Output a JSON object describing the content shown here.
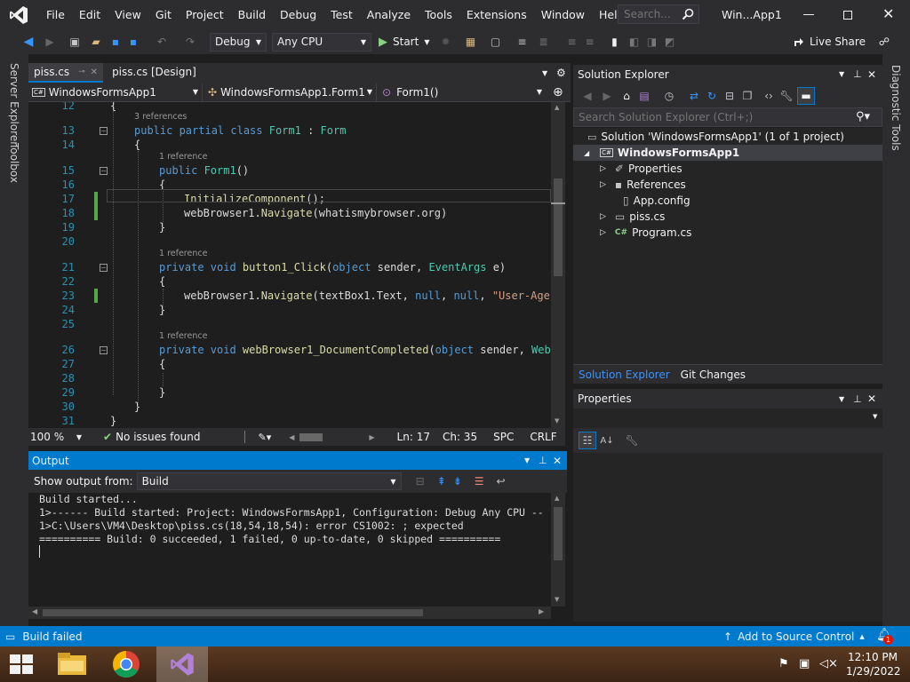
{
  "menubar": {
    "items": [
      "File",
      "Edit",
      "View",
      "Git",
      "Project",
      "Build",
      "Debug",
      "Test",
      "Analyze",
      "Tools",
      "Extensions",
      "Window",
      "Help"
    ],
    "search_placeholder": "Search...",
    "window_title": "Win...App1"
  },
  "toolbar": {
    "config": "Debug",
    "platform": "Any CPU",
    "start_label": "Start",
    "live_share_label": "Live Share"
  },
  "left_tabs": {
    "server_explorer": "Server Explorer",
    "toolbox": "Toolbox"
  },
  "right_tabs": {
    "diagnostic_tools": "Diagnostic Tools"
  },
  "editor": {
    "tabs": [
      "piss.cs",
      "piss.cs [Design]"
    ],
    "nav": {
      "project": "WindowsFormsApp1",
      "class": "WindowsFormsApp1.Form1",
      "member": "Form1()"
    },
    "lines": [
      {
        "n": "12",
        "parts": [
          {
            "t": "{",
            "c": ""
          }
        ]
      },
      {
        "n": "13",
        "lens": "3 references",
        "parts": [
          {
            "t": "public ",
            "c": "kw"
          },
          {
            "t": "partial ",
            "c": "kw"
          },
          {
            "t": "class ",
            "c": "kw"
          },
          {
            "t": "Form1",
            "c": "ty"
          },
          {
            "t": " : ",
            "c": ""
          },
          {
            "t": "Form",
            "c": "ty"
          }
        ]
      },
      {
        "n": "14",
        "parts": [
          {
            "t": "{",
            "c": ""
          }
        ]
      },
      {
        "n": "15",
        "lens": "1 reference",
        "parts": [
          {
            "t": "public ",
            "c": "kw"
          },
          {
            "t": "Form1",
            "c": "ty"
          },
          {
            "t": "()",
            "c": ""
          }
        ]
      },
      {
        "n": "16",
        "parts": [
          {
            "t": "{",
            "c": ""
          }
        ]
      },
      {
        "n": "17",
        "parts": [
          {
            "t": "InitializeComponent",
            "c": "fn"
          },
          {
            "t": "();",
            "c": ""
          }
        ]
      },
      {
        "n": "18",
        "parts": [
          {
            "t": "webBrowser1",
            "c": ""
          },
          {
            "t": ".",
            "c": ""
          },
          {
            "t": "Navigate",
            "c": "fn"
          },
          {
            "t": "(whatismybrowser.org)",
            "c": ""
          }
        ]
      },
      {
        "n": "19",
        "parts": [
          {
            "t": "}",
            "c": ""
          }
        ]
      },
      {
        "n": "20",
        "parts": [
          {
            "t": "",
            "c": ""
          }
        ]
      },
      {
        "n": "21",
        "lens": "1 reference",
        "parts": [
          {
            "t": "private ",
            "c": "kw"
          },
          {
            "t": "void ",
            "c": "kw"
          },
          {
            "t": "button1_Click",
            "c": "fn"
          },
          {
            "t": "(",
            "c": ""
          },
          {
            "t": "object ",
            "c": "kw"
          },
          {
            "t": "sender, ",
            "c": ""
          },
          {
            "t": "EventArgs ",
            "c": "ty"
          },
          {
            "t": "e)",
            "c": ""
          }
        ]
      },
      {
        "n": "22",
        "parts": [
          {
            "t": "{",
            "c": ""
          }
        ]
      },
      {
        "n": "23",
        "parts": [
          {
            "t": "webBrowser1.",
            "c": ""
          },
          {
            "t": "Navigate",
            "c": "fn"
          },
          {
            "t": "(textBox1.Text, ",
            "c": ""
          },
          {
            "t": "null",
            "c": "kw"
          },
          {
            "t": ", ",
            "c": ""
          },
          {
            "t": "null",
            "c": "kw"
          },
          {
            "t": ", ",
            "c": ""
          },
          {
            "t": "\"User-Agent",
            "c": "st"
          }
        ]
      },
      {
        "n": "24",
        "parts": [
          {
            "t": "}",
            "c": ""
          }
        ]
      },
      {
        "n": "25",
        "parts": [
          {
            "t": "",
            "c": ""
          }
        ]
      },
      {
        "n": "26",
        "lens": "1 reference",
        "parts": [
          {
            "t": "private ",
            "c": "kw"
          },
          {
            "t": "void ",
            "c": "kw"
          },
          {
            "t": "webBrowser1_DocumentCompleted",
            "c": "fn"
          },
          {
            "t": "(",
            "c": ""
          },
          {
            "t": "object ",
            "c": "kw"
          },
          {
            "t": "sender, ",
            "c": ""
          },
          {
            "t": "WebBr",
            "c": "ty"
          }
        ]
      },
      {
        "n": "27",
        "parts": [
          {
            "t": "{",
            "c": ""
          }
        ]
      },
      {
        "n": "28",
        "parts": [
          {
            "t": "",
            "c": ""
          }
        ]
      },
      {
        "n": "29",
        "parts": [
          {
            "t": "}",
            "c": ""
          }
        ]
      },
      {
        "n": "30",
        "parts": [
          {
            "t": "}",
            "c": ""
          }
        ]
      },
      {
        "n": "31",
        "parts": [
          {
            "t": "}",
            "c": ""
          }
        ]
      }
    ],
    "zoom": "100 %",
    "issues": "No issues found",
    "ln": "Ln: 17",
    "ch": "Ch: 35",
    "spc": "SPC",
    "crlf": "CRLF"
  },
  "output": {
    "title": "Output",
    "show_from_label": "Show output from:",
    "source": "Build",
    "lines": [
      "Build started...",
      "1>------ Build started: Project: WindowsFormsApp1, Configuration: Debug Any CPU --",
      "1>C:\\Users\\VM4\\Desktop\\piss.cs(18,54,18,54): error CS1002: ; expected",
      "========== Build: 0 succeeded, 1 failed, 0 up-to-date, 0 skipped =========="
    ]
  },
  "solution_explorer": {
    "title": "Solution Explorer",
    "search_placeholder": "Search Solution Explorer (Ctrl+;)",
    "solution": "Solution 'WindowsFormsApp1' (1 of 1 project)",
    "project": "WindowsFormsApp1",
    "items": [
      "Properties",
      "References",
      "App.config",
      "piss.cs",
      "Program.cs"
    ],
    "tab_active": "Solution Explorer",
    "tab_other": "Git Changes"
  },
  "properties": {
    "title": "Properties"
  },
  "statusbar": {
    "build_status": "Build failed",
    "source_control": "Add to Source Control",
    "notification_count": "1"
  },
  "taskbar": {
    "time": "12:10 PM",
    "date": "1/29/2022"
  },
  "colors": {
    "accent": "#007acc",
    "keyword": "#569cd6",
    "type": "#4ec9b0",
    "method": "#dcdcaa",
    "string": "#d69d85",
    "line_number": "#2b91af"
  }
}
